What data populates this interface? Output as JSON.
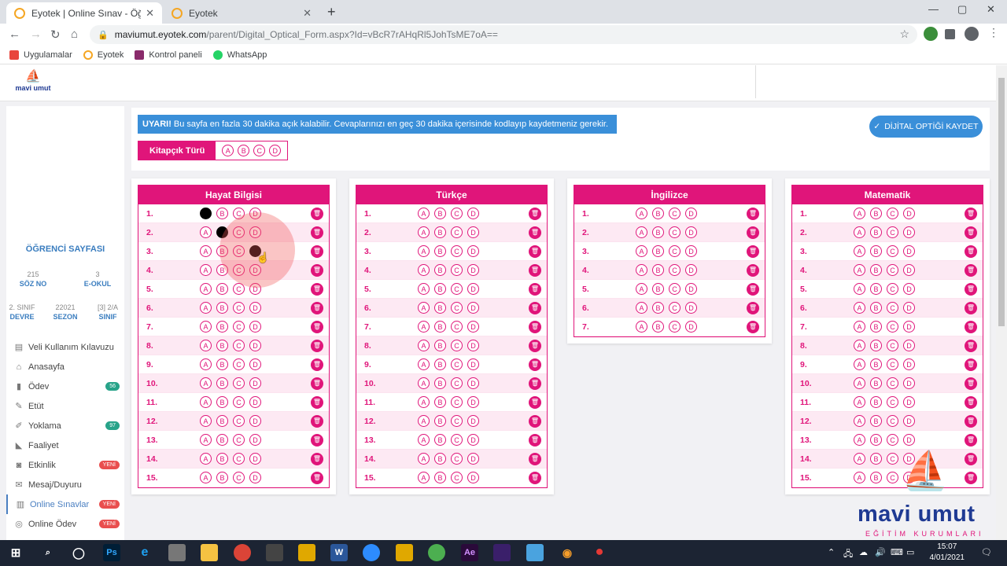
{
  "browser": {
    "tabs": [
      {
        "title": "Eyotek | Online Sınav - Öğrenci S"
      },
      {
        "title": "Eyotek"
      }
    ],
    "url_host": "maviumut.eyotek.com",
    "url_path": "/parent/Digital_Optical_Form.aspx?Id=vBcR7rAHqRl5JohTsME7oA==",
    "bookmarks": [
      "Uygulamalar",
      "Eyotek",
      "Kontrol paneli",
      "WhatsApp"
    ]
  },
  "sidebar": {
    "logo": "mavi umut",
    "title": "ÖĞRENCİ SAYFASI",
    "stats": [
      {
        "value": "215",
        "label": "SÖZ NO"
      },
      {
        "value": "3",
        "label": "E-OKUL"
      },
      {
        "value": "2. SINIF",
        "label": "DEVRE"
      },
      {
        "value": "22021",
        "label": "SEZON"
      },
      {
        "value": "[3] 2/A",
        "label": "SINIF"
      }
    ],
    "menu": [
      {
        "label": "Veli Kullanım Kılavuzu",
        "icon": "book-icon",
        "badge": ""
      },
      {
        "label": "Anasayfa",
        "icon": "home-icon",
        "badge": ""
      },
      {
        "label": "Ödev",
        "icon": "file-icon",
        "badge": "56"
      },
      {
        "label": "Etüt",
        "icon": "edit-icon",
        "badge": ""
      },
      {
        "label": "Yoklama",
        "icon": "pencil-icon",
        "badge": "97"
      },
      {
        "label": "Faaliyet",
        "icon": "bullhorn-icon",
        "badge": ""
      },
      {
        "label": "Etkinlik",
        "icon": "camera-icon",
        "badge": "YENİ"
      },
      {
        "label": "Mesaj/Duyuru",
        "icon": "mail-icon",
        "badge": ""
      },
      {
        "label": "Online Sınavlar",
        "icon": "chart-icon",
        "badge": "YENİ"
      },
      {
        "label": "Online Ödev",
        "icon": "circle-icon",
        "badge": "YENİ"
      }
    ]
  },
  "header": {
    "warning_bold": "UYARI!",
    "warning_text": "Bu sayfa en fazla 30 dakika açık kalabilir. Cevaplarınızı en geç 30 dakika içerisinde kodlayıp kaydetmeniz gerekir.",
    "save_label": "DİJİTAL OPTİĞİ KAYDET",
    "booklet_label": "Kitapçık Türü",
    "booklet_options": [
      "A",
      "B",
      "C",
      "D"
    ]
  },
  "options": [
    "A",
    "B",
    "C",
    "D"
  ],
  "sections": [
    {
      "title": "Hayat Bilgisi",
      "questions": 15,
      "answers": {
        "1": "A",
        "2": "B",
        "3": "D"
      }
    },
    {
      "title": "Türkçe",
      "questions": 15,
      "answers": {}
    },
    {
      "title": "İngilizce",
      "questions": 7,
      "answers": {}
    },
    {
      "title": "Matematik",
      "questions": 15,
      "answers": {}
    }
  ],
  "brand": {
    "name": "mavi umut",
    "subtitle": "EĞİTİM KURUMLARI"
  },
  "taskbar": {
    "time": "15:07",
    "date": "4/01/2021"
  },
  "colors": {
    "accent": "#e0157a",
    "primary": "#3a8fd9"
  }
}
